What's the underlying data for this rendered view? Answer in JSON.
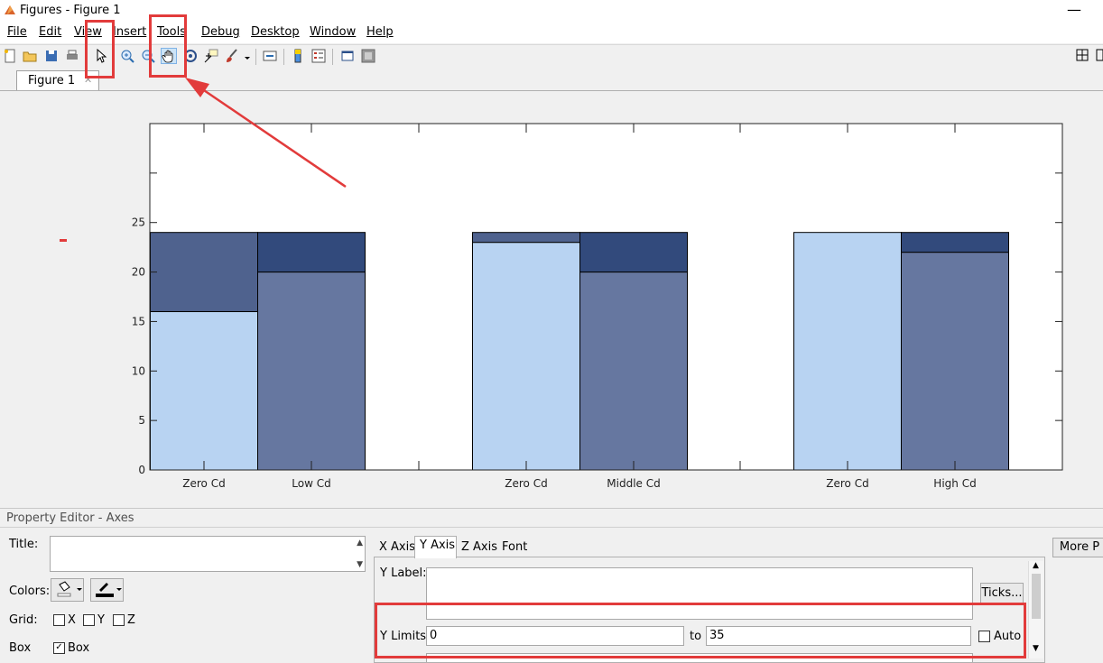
{
  "window": {
    "title": "Figures - Figure 1"
  },
  "menu": [
    "File",
    "Edit",
    "View",
    "Insert",
    "Tools",
    "Debug",
    "Desktop",
    "Window",
    "Help"
  ],
  "toolbar_icons": [
    "new-figure-icon",
    "open-icon",
    "save-icon",
    "print-icon",
    "pointer-icon",
    "zoom-in-icon",
    "zoom-out-icon",
    "pan-icon",
    "rotate-icon",
    "data-cursor-icon",
    "brush-icon",
    "link-icon",
    "colorbar-icon",
    "legend-icon",
    "hide-plot-tools-icon",
    "show-plot-tools-icon",
    "tile-icon"
  ],
  "tab": {
    "label": "Figure 1"
  },
  "chart_data": {
    "type": "bar",
    "stacked": true,
    "categories": [
      "Zero Cd",
      "Low Cd",
      "Zero Cd",
      "Middle Cd",
      "Zero Cd",
      "High Cd"
    ],
    "series": [
      {
        "values": [
          16,
          20,
          23,
          20,
          24,
          22
        ],
        "colors": [
          "#b8d3f2",
          "#6677a0",
          "#b8d3f2",
          "#6677a0",
          "#b8d3f2",
          "#6677a0"
        ]
      },
      {
        "values": [
          8,
          4,
          1,
          4,
          0,
          2
        ],
        "colors": [
          "#4f628e",
          "#324a7c",
          "#4f628e",
          "#324a7c",
          "#4f628e",
          "#324a7c"
        ]
      }
    ],
    "yticks": [
      0,
      5,
      10,
      15,
      20,
      25
    ],
    "ylim": [
      0,
      35
    ],
    "title": "",
    "xlabel": "",
    "ylabel": "",
    "grid": false,
    "box": true
  },
  "prop": {
    "header": "Property Editor - Axes",
    "title_label": "Title:",
    "title_value": "",
    "colors_label": "Colors:",
    "grid_label": "Grid:",
    "grid_x": "X",
    "grid_y": "Y",
    "grid_z": "Z",
    "box_label": "Box",
    "box_check_label": "Box",
    "tabs": [
      "X Axis",
      "Y Axis",
      "Z Axis",
      "Font"
    ],
    "ylabel_label": "Y Label:",
    "ylabel_value": "",
    "ticks_button": "Ticks...",
    "ylimits_label": "Y Limits:",
    "ylim_from": "0",
    "to_label": "to",
    "ylim_to": "35",
    "auto_label": "Auto",
    "more_button": "More P"
  }
}
